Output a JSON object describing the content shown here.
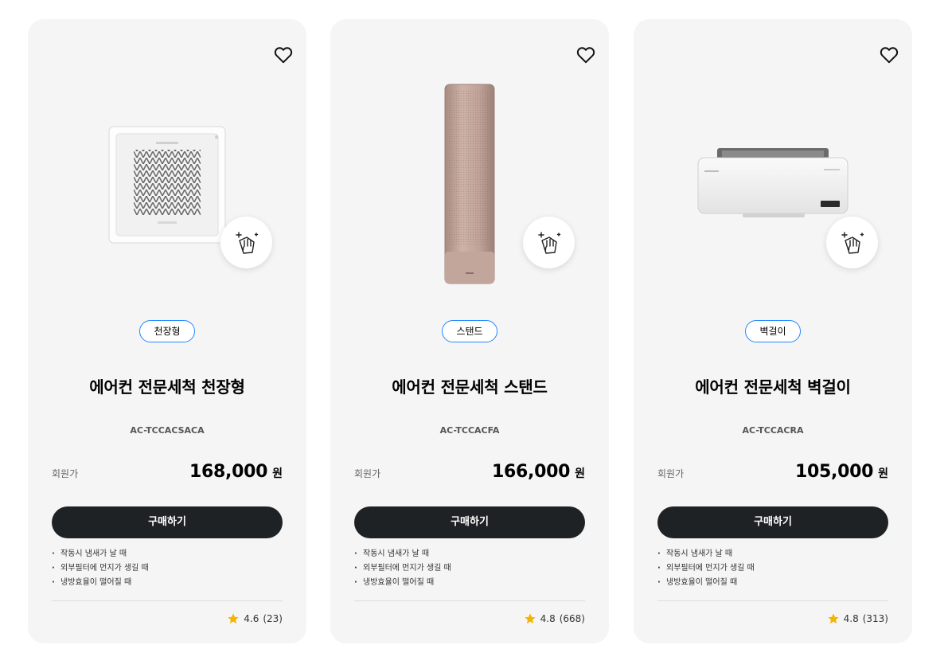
{
  "colors": {
    "badge_border": "#2189ff",
    "button": "#1e2224",
    "card": "#f5f5f5",
    "star": "#f4b400"
  },
  "products": [
    {
      "image": "ceiling-cassette-air-conditioner-image",
      "badge": "천장형",
      "title": "에어컨 전문세척 천장형",
      "model": "AC-TCCACSACA",
      "price_label": "회원가",
      "price": "168,000",
      "currency": "원",
      "buy_label": "구매하기",
      "features": [
        "작동시 냄새가 날 때",
        "외부필터에 먼지가 생길 때",
        "냉방효율이 떨어질 때"
      ],
      "rating": "4.6",
      "review_count": "(23)"
    },
    {
      "image": "stand-air-conditioner-image",
      "badge": "스탠드",
      "title": "에어컨 전문세척 스탠드",
      "model": "AC-TCCACFA",
      "price_label": "회원가",
      "price": "166,000",
      "currency": "원",
      "buy_label": "구매하기",
      "features": [
        "작동시 냄새가 날 때",
        "외부필터에 먼지가 생길 때",
        "냉방효율이 떨어질 때"
      ],
      "rating": "4.8",
      "review_count": "(668)"
    },
    {
      "image": "wall-mounted-air-conditioner-image",
      "badge": "벽걸이",
      "title": "에어컨 전문세척 벽걸이",
      "model": "AC-TCCACRA",
      "price_label": "회원가",
      "price": "105,000",
      "currency": "원",
      "buy_label": "구매하기",
      "features": [
        "작동시 냄새가 날 때",
        "외부필터에 먼지가 생길 때",
        "냉방효율이 떨어질 때"
      ],
      "rating": "4.8",
      "review_count": "(313)"
    }
  ]
}
